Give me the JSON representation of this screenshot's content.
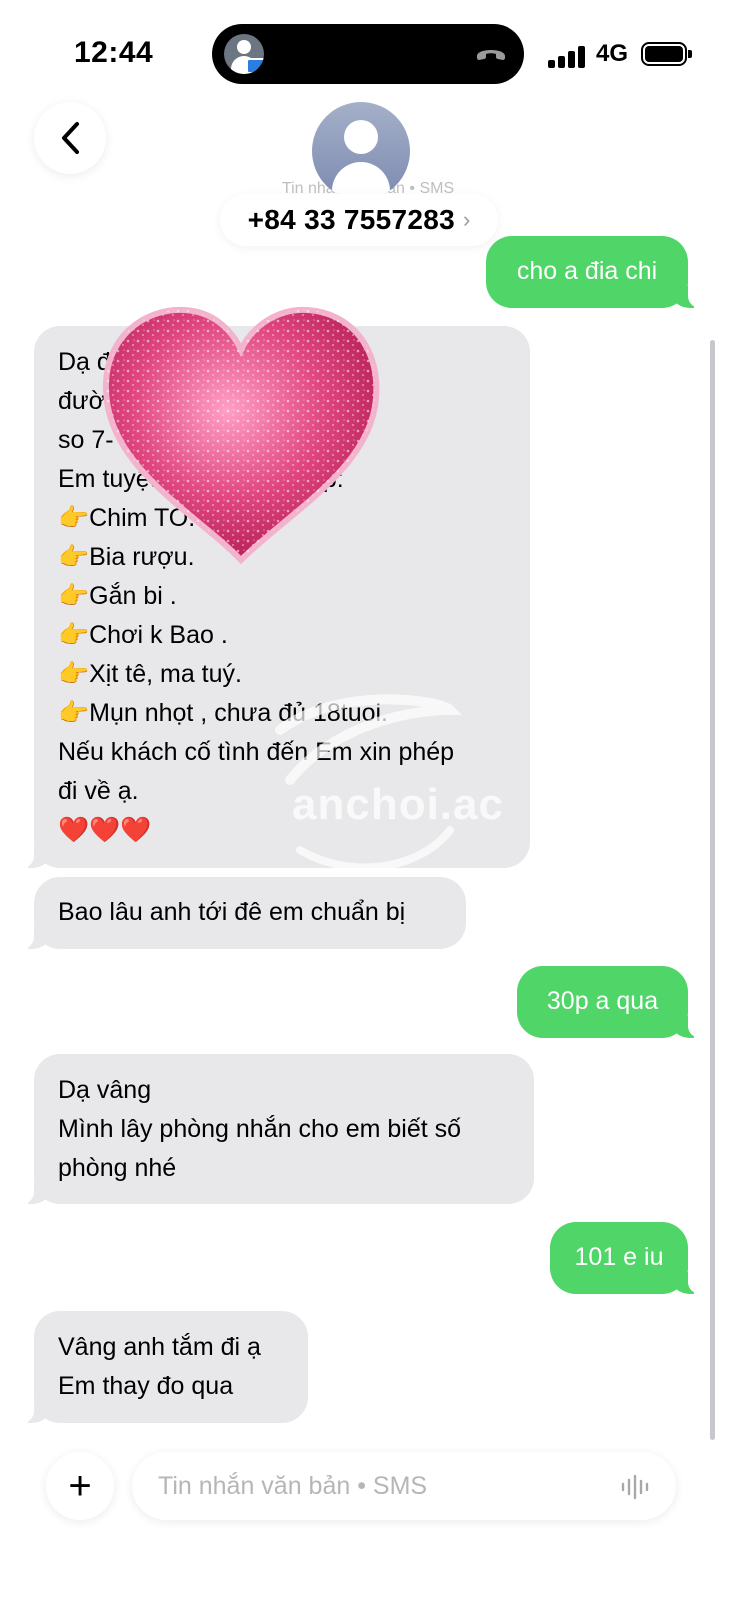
{
  "status_bar": {
    "time": "12:44",
    "network": "4G"
  },
  "header": {
    "sub_label": "Tin nhắn văn bản • SMS",
    "contact_number": "+84 33 7557283",
    "chevron": "›"
  },
  "messages": [
    {
      "dir": "out",
      "text": "cho a đia chi"
    },
    {
      "dir": "in",
      "text": "Dạ đ                    o 200\nđườ\nso 7-                   uận 8.\nEm tuyệt            các trường hợp:\n👉Chim TO.\n👉Bia rượu.\n👉Gắn bi .\n👉Chơi k Bao .\n👉Xịt tê, ma tuý.\n👉Mụn nhọt , chưa đủ 18tuoi.\nNếu khách cố tình đến Em xin phép\nđi về ạ.\n❤️❤️❤️"
    },
    {
      "dir": "in",
      "text": "Bao lâu anh tới đê em chuẩn bị"
    },
    {
      "dir": "out",
      "text": "30p a qua"
    },
    {
      "dir": "in",
      "text": "Dạ vâng\nMình lây phòng nhắn cho em biết số\nphòng nhé"
    },
    {
      "dir": "out",
      "text": "101 e iu"
    },
    {
      "dir": "in",
      "text": "Vâng anh tắm đi ạ\nEm thay đo qua"
    }
  ],
  "watermark": "anchoi.ac",
  "input": {
    "placeholder": "Tin nhắn văn bản • SMS",
    "plus": "+"
  },
  "icons": {
    "back": "chevron-left-icon",
    "avatar": "person-icon",
    "mic": "waveform-icon",
    "plus": "plus-icon",
    "sticker": "heart-sticker"
  },
  "colors": {
    "outgoing": "#4fd568",
    "incoming": "#e8e8ea",
    "sticker": "#e0457f"
  }
}
